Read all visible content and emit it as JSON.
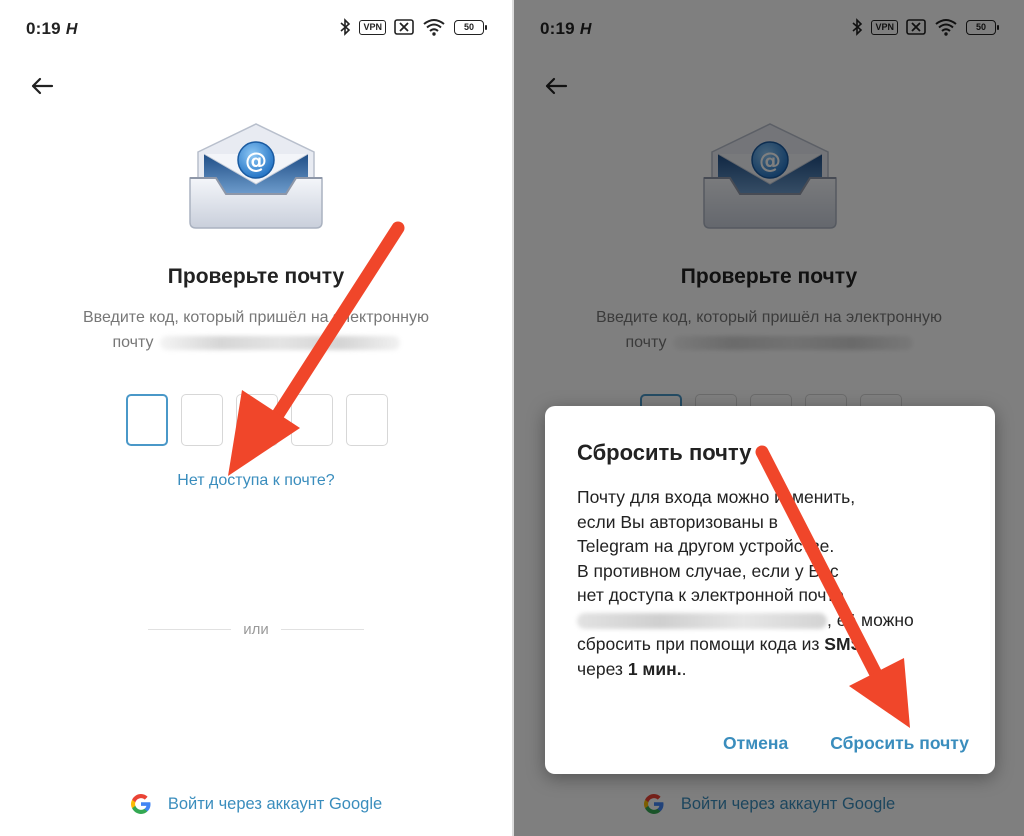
{
  "status": {
    "time": "0:19",
    "logo_glyph": "H",
    "vpn_label": "VPN",
    "battery": "50",
    "icons": [
      "bluetooth-icon",
      "vpn-icon",
      "sim-off-icon",
      "wifi-icon",
      "battery-icon"
    ]
  },
  "screen": {
    "title": "Проверьте почту",
    "subtitle_line1": "Введите код, который пришёл на электронную",
    "subtitle_line2": "почту",
    "code_length": 5,
    "no_access_link": "Нет доступа к почте?",
    "divider_text": "или",
    "google_signin": "Войти через аккаунт Google"
  },
  "dialog": {
    "title": "Сбросить почту",
    "body": {
      "l1": "Почту для входа можно изменить,",
      "l2": "если Вы авторизованы в",
      "l3": "Telegram на другом устройстве.",
      "l4": "В противном случае, если у Вас",
      "l5": "нет доступа к электронной почте",
      "l6_suffix": ", её можно",
      "l7_prefix": "сбросить при помощи кода из ",
      "l7_bold": "SMS",
      "l8_prefix": "через ",
      "l8_bold": "1 мин.",
      "l8_suffix": "."
    },
    "cancel": "Отмена",
    "confirm": "Сбросить почту"
  },
  "colors": {
    "accent": "#3a8dbd",
    "arrow": "#f0462a",
    "overlay": "rgba(0,0,0,0.5)"
  }
}
